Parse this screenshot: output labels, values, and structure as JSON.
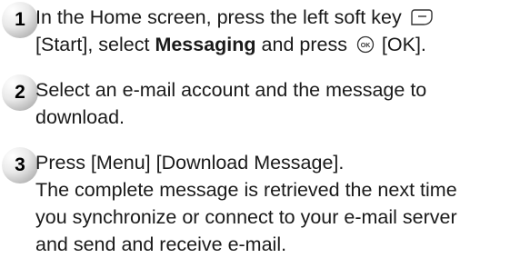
{
  "steps": [
    {
      "number": "1",
      "lines": [
        {
          "pre": "In the Home screen, press the left soft key ",
          "icon": "soft-key-icon"
        },
        {
          "pre": "[Start], select ",
          "bold": "Messaging",
          "mid": " and press ",
          "icon": "ok-key-icon",
          "post": " [OK]."
        }
      ]
    },
    {
      "number": "2",
      "lines": [
        "Select an e-mail account and the message to",
        "download."
      ]
    },
    {
      "number": "3",
      "lines": [
        "Press [Menu] [Download Message].",
        "The complete message is retrieved the next time",
        "you synchronize or connect to your e-mail server",
        "and send and receive e-mail."
      ]
    }
  ]
}
